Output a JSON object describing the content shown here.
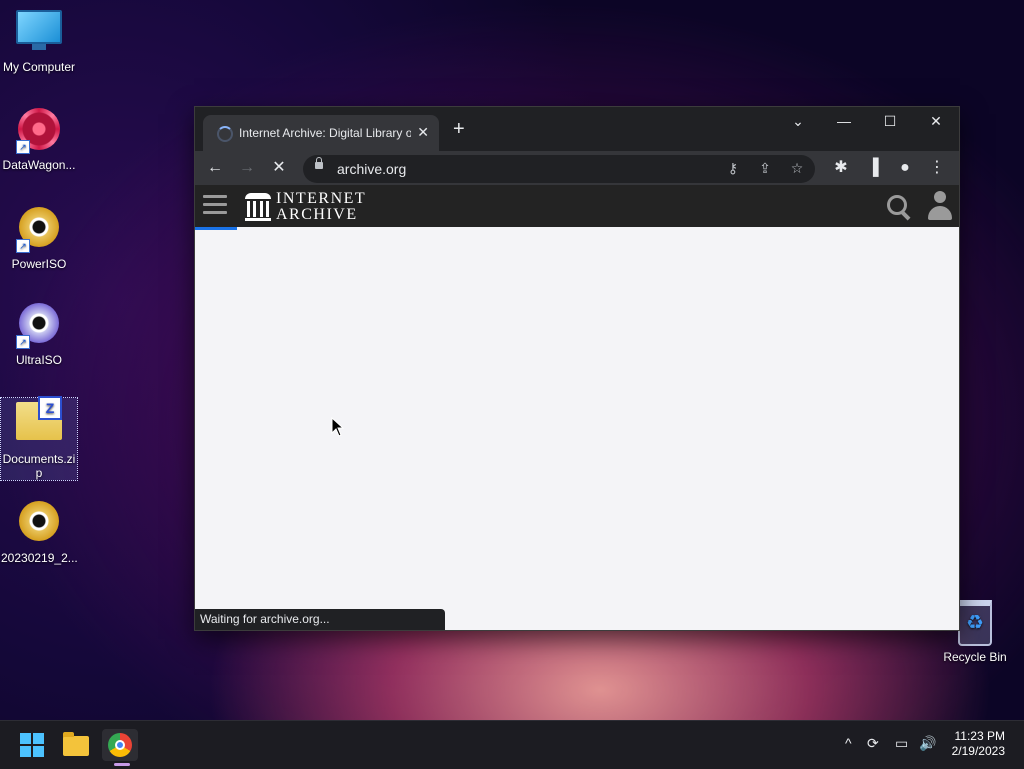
{
  "desktop": {
    "icons": [
      {
        "label": "My Computer",
        "icon": "computer-icon"
      },
      {
        "label": "DataWagon...",
        "icon": "datawagon-icon"
      },
      {
        "label": "PowerISO",
        "icon": "poweriso-icon"
      },
      {
        "label": "UltraISO",
        "icon": "ultraiso-icon"
      },
      {
        "label": "Documents.zip",
        "icon": "zip-folder-icon"
      },
      {
        "label": "20230219_2...",
        "icon": "disc-image-icon"
      }
    ],
    "recycle_bin_label": "Recycle Bin"
  },
  "browser": {
    "tab_title": "Internet Archive: Digital Library of Free & Borrowable Books, Movies, Music & Wayback Machine",
    "tab_close": "✕",
    "new_tab": "+",
    "tab_search": "⌄",
    "minimize": "—",
    "maximize": "☐",
    "close": "✕",
    "back": "←",
    "forward": "→",
    "stop": "✕",
    "url": "archive.org",
    "status_text": "Waiting for archive.org..."
  },
  "site": {
    "logo_line1": "INTERNET",
    "logo_line2": "ARCHIVE"
  },
  "taskbar": {
    "time": "11:23 PM",
    "date": "2/19/2023",
    "tray_chevron": "^"
  }
}
